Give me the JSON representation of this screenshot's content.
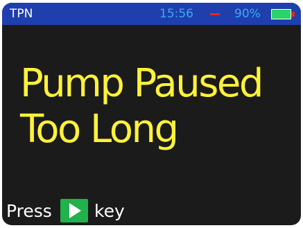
{
  "status_bar": {
    "app_title": "TPN",
    "clock": "15:56",
    "battery_percent": "90%",
    "battery_level": 0.9,
    "colors": {
      "background": "#1f3fae",
      "clock_text": "#3aaaf0",
      "alert_dash": "#e32828",
      "battery_fill": "#2bd46a"
    }
  },
  "alarm": {
    "message_line_1": "Pump Paused",
    "message_line_2": "Too Long",
    "color": "#fff23a"
  },
  "prompt": {
    "before": "Press",
    "key_icon": "play-icon",
    "after": "key",
    "key_color": "#21b24b"
  }
}
